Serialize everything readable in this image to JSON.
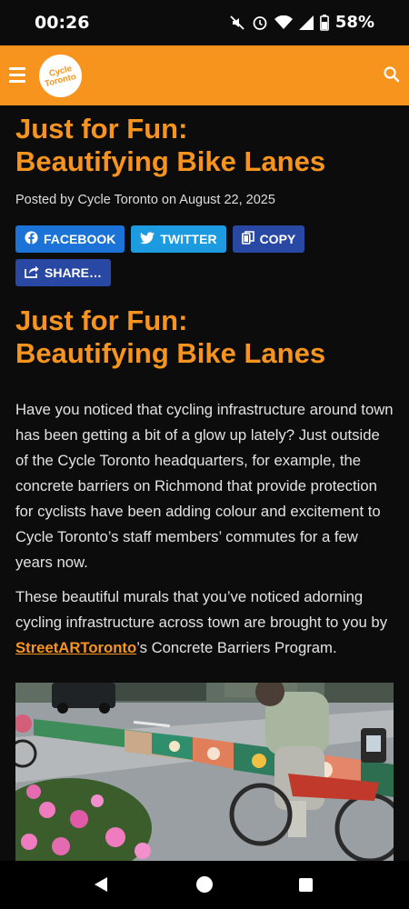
{
  "status_bar": {
    "time": "00:26",
    "battery": "58%"
  },
  "header": {
    "logo_line1": "Cycle",
    "logo_line2": "Toronto",
    "brand_color": "#f7941d"
  },
  "article": {
    "title_line1": "Just for Fun:",
    "title_line2": "Beautifying Bike Lanes",
    "byline": "Posted by Cycle Toronto on August 22, 2025",
    "share_buttons": {
      "facebook": "FACEBOOK",
      "twitter": "TWITTER",
      "copy": "COPY",
      "share": "SHARE…"
    },
    "heading_line1": "Just for Fun:",
    "heading_line2": "Beautifying Bike Lanes",
    "paragraph1": "Have you noticed that cycling infrastructure around town has been getting a bit of a glow up lately? Just outside of the Cycle Toronto headquarters, for example, the concrete barriers on Richmond that provide protection for cyclists have been adding colour and excitement to Cycle Toronto’s staff members’ commutes for a few years now.",
    "paragraph2_before": "These beautiful murals that you’ve noticed adorning cycling infrastructure across town are brought to you by ",
    "paragraph2_link": "StreetARToronto",
    "paragraph2_after": "’s Concrete Barriers Program."
  },
  "icons": {
    "menu": "hamburger-icon",
    "search": "search-icon",
    "facebook": "facebook-icon",
    "twitter": "twitter-icon",
    "copy": "copy-icon",
    "share": "share-icon"
  }
}
